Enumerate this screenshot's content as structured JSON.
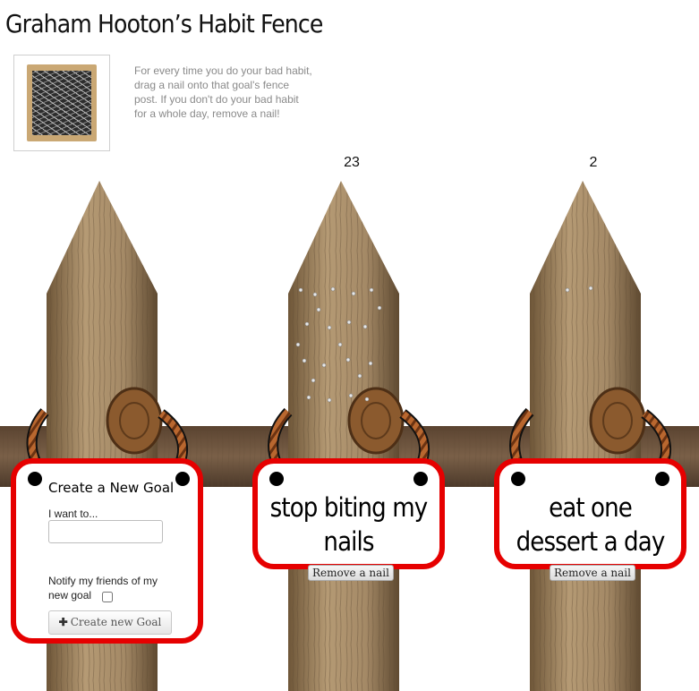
{
  "page": {
    "title": "Graham Hooton’s Habit Fence",
    "instructions": "For every time you do your bad habit, drag a nail onto that goal's fence post. If you don't do your bad habit for a whole day, remove a nail!"
  },
  "thumbnail": {
    "icon": "nail-box-icon"
  },
  "create_goal": {
    "title": "Create a New Goal",
    "want_label": "I want to...",
    "want_value": "",
    "notify_label": "Notify my friends of my new goal",
    "notify_checked": false,
    "button_label": "Create new Goal",
    "button_icon": "plus-icon"
  },
  "goals": [
    {
      "count": "23",
      "text": "stop biting my nails",
      "remove_label": "Remove a nail"
    },
    {
      "count": "2",
      "text": "eat one dessert a day",
      "remove_label": "Remove a nail"
    }
  ],
  "colors": {
    "sign_border": "#e60000",
    "wood": "#8b6a44",
    "rope": "#b9672f"
  }
}
